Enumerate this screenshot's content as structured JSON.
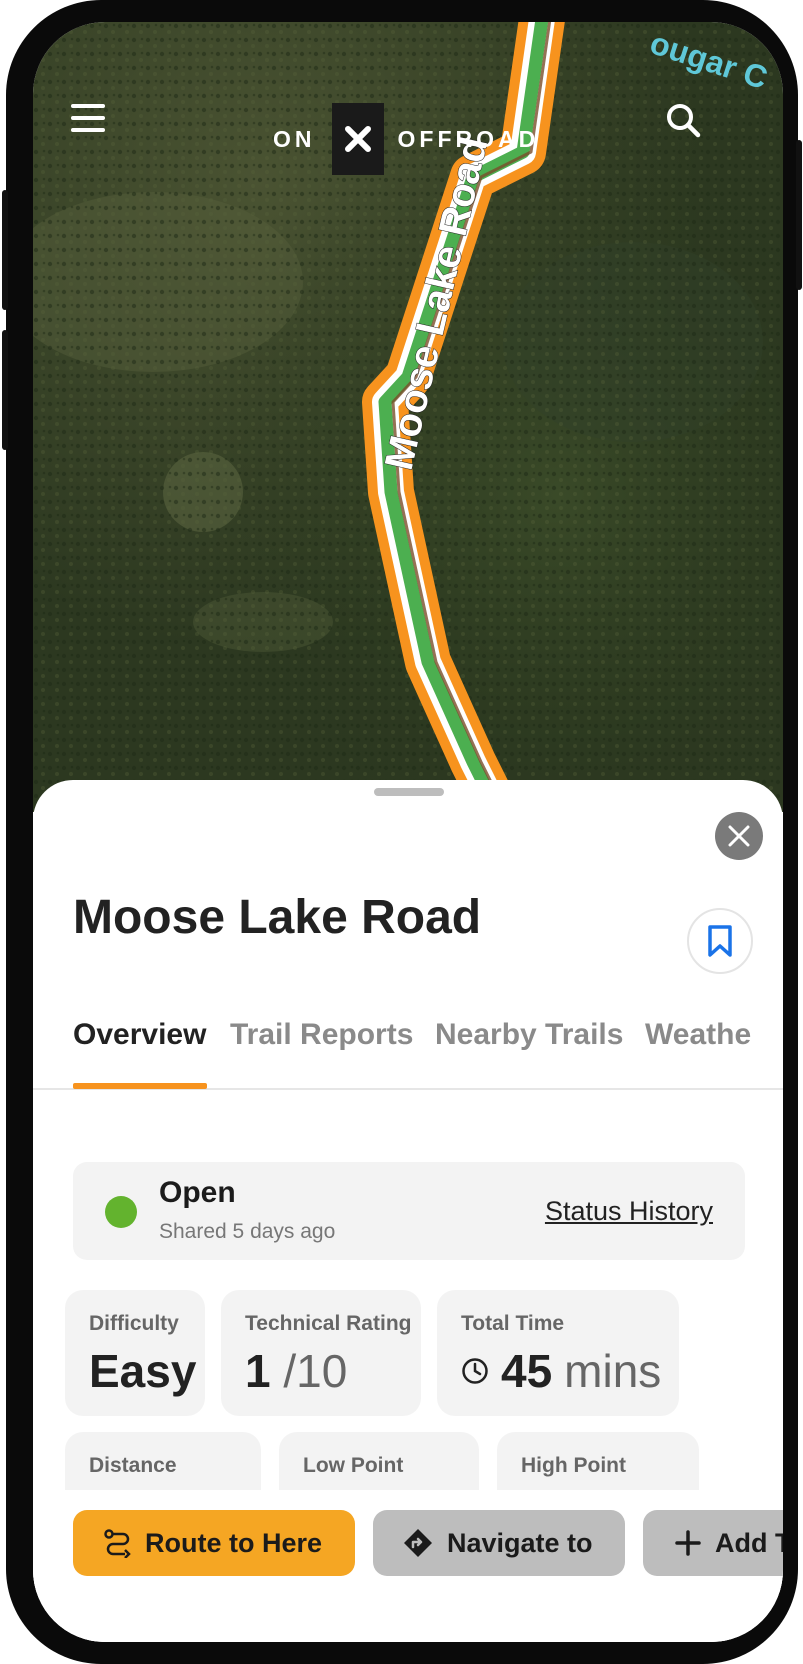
{
  "app": {
    "logo_left": "ON",
    "logo_mark": "✕",
    "logo_right": "OFFROAD",
    "menu_icon": "hamburger-menu-icon",
    "search_icon": "search-icon"
  },
  "map": {
    "trail_label": "Moose Lake Road",
    "corner_label": "ougar C",
    "route_color": "#f7931e",
    "trail_color": "#4caf50"
  },
  "trail": {
    "name": "Moose Lake Road",
    "close_icon": "close-icon",
    "bookmark_icon": "bookmark-icon"
  },
  "tabs": [
    {
      "label": "Overview",
      "active": true
    },
    {
      "label": "Trail Reports",
      "active": false
    },
    {
      "label": "Nearby Trails",
      "active": false
    },
    {
      "label": "Weathe",
      "active": false
    }
  ],
  "status": {
    "label": "Open",
    "shared": "Shared 5 days ago",
    "link": "Status History",
    "color": "#63b32e"
  },
  "stats_row1": {
    "difficulty": {
      "label": "Difficulty",
      "value": "Easy"
    },
    "technical": {
      "label": "Technical Rating",
      "value": "1",
      "unit": "/10"
    },
    "time": {
      "label": "Total Time",
      "value": "45",
      "unit": "mins",
      "icon": "clock-icon"
    }
  },
  "stats_row2": {
    "distance": {
      "label": "Distance"
    },
    "low_point": {
      "label": "Low Point"
    },
    "high_point": {
      "label": "High Point"
    }
  },
  "actions": {
    "route": {
      "label": "Route to Here",
      "icon": "route-icon",
      "color": "#f5a623"
    },
    "navigate": {
      "label": "Navigate to",
      "icon": "navigate-icon"
    },
    "add": {
      "label": "Add T",
      "icon": "plus-icon"
    }
  }
}
